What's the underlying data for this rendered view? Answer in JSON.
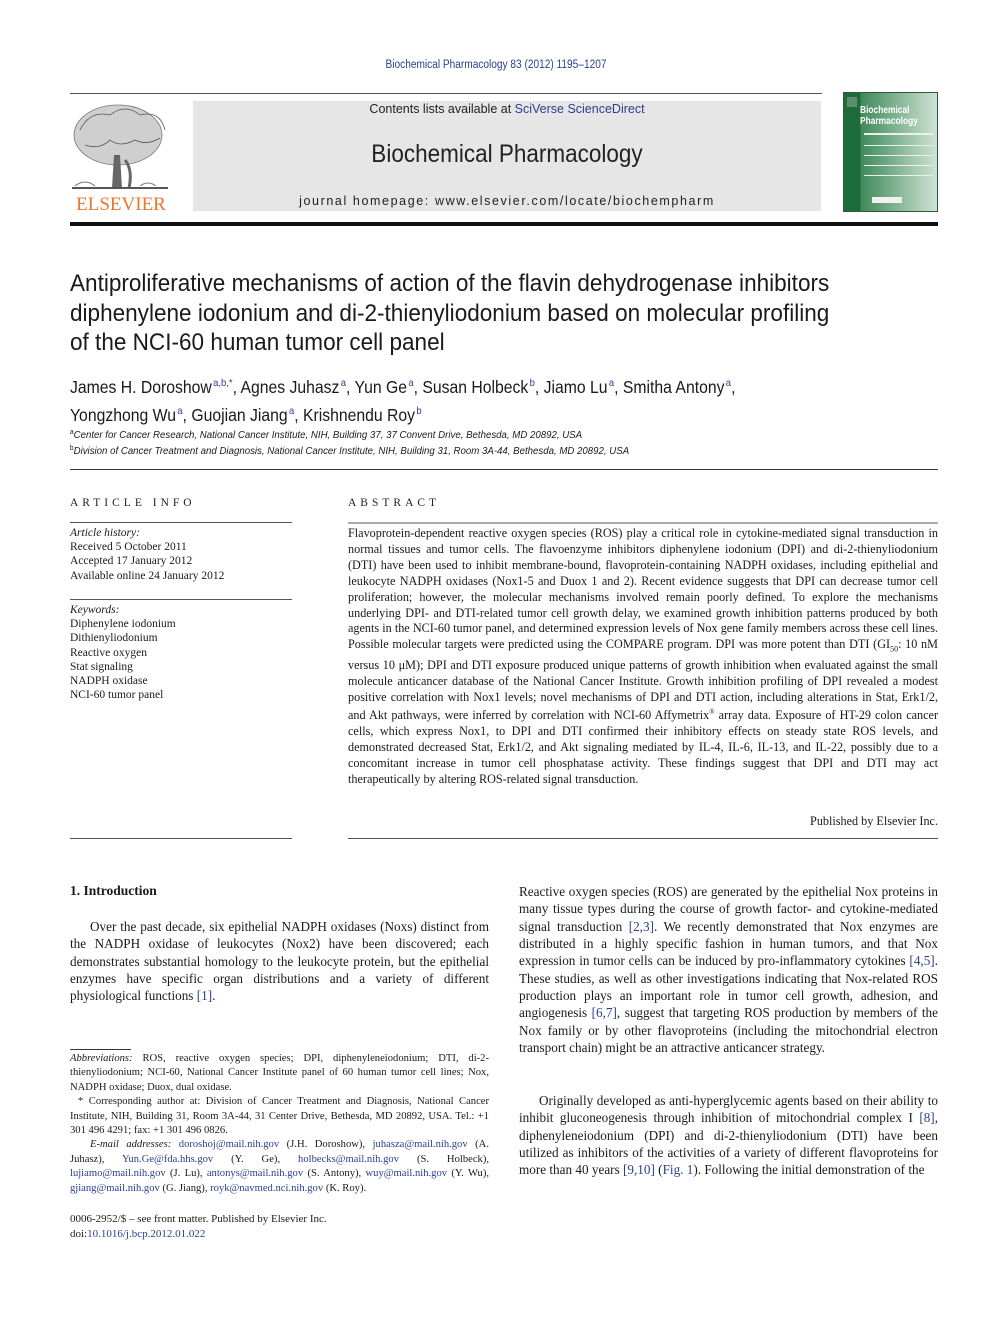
{
  "header": {
    "journal_ref": "Biochemical Pharmacology 83 (2012) 1195–1207",
    "contents_prefix": "Contents lists available at ",
    "contents_link": "SciVerse ScienceDirect",
    "journal_title": "Biochemical Pharmacology",
    "homepage": "journal homepage: www.elsevier.com/locate/biochempharm",
    "publisher_logo": "ELSEVIER",
    "cover_title_line1": "Biochemical",
    "cover_title_line2": "Pharmacology",
    "colors": {
      "link": "#2a3f8f",
      "elsevier_orange": "#e8762c",
      "cover_green": "#1e6b3c",
      "banner_gray": "#e6e6e6"
    }
  },
  "article": {
    "title_lines": [
      "Antiproliferative mechanisms of action of the flavin dehydrogenase inhibitors",
      "diphenylene iodonium and di-2-thienyliodonium based on molecular profiling",
      "of the NCI-60 human tumor cell panel"
    ],
    "authors": [
      {
        "name": "James H. Doroshow",
        "sup": "a,b,*"
      },
      {
        "name": "Agnes Juhasz",
        "sup": "a"
      },
      {
        "name": "Yun Ge",
        "sup": "a"
      },
      {
        "name": "Susan Holbeck",
        "sup": "b"
      },
      {
        "name": "Jiamo Lu",
        "sup": "a"
      },
      {
        "name": "Smitha Antony",
        "sup": "a"
      },
      {
        "name": "Yongzhong Wu",
        "sup": "a"
      },
      {
        "name": "Guojian Jiang",
        "sup": "a"
      },
      {
        "name": "Krishnendu Roy",
        "sup": "b"
      }
    ],
    "affiliations": [
      {
        "sup": "a",
        "text": "Center for Cancer Research, National Cancer Institute, NIH, Building 37, 37 Convent Drive, Bethesda, MD 20892, USA"
      },
      {
        "sup": "b",
        "text": "Division of Cancer Treatment and Diagnosis, National Cancer Institute, NIH, Building 31, Room 3A-44, Bethesda, MD 20892, USA"
      }
    ]
  },
  "article_info": {
    "heading": "ARTICLE INFO",
    "history_label": "Article history:",
    "history": [
      "Received 5 October 2011",
      "Accepted 17 January 2012",
      "Available online 24 January 2012"
    ],
    "keywords_label": "Keywords:",
    "keywords": [
      "Diphenylene iodonium",
      "Dithienyliodonium",
      "Reactive oxygen",
      "Stat signaling",
      "NADPH oxidase",
      "NCI-60 tumor panel"
    ]
  },
  "abstract": {
    "heading": "ABSTRACT",
    "text_part1": "Flavoprotein-dependent reactive oxygen species (ROS) play a critical role in cytokine-mediated signal transduction in normal tissues and tumor cells. The flavoenzyme inhibitors diphenylene iodonium (DPI) and di-2-thienyliodonium (DTI) have been used to inhibit membrane-bound, flavoprotein-containing NADPH oxidases, including epithelial and leukocyte NADPH oxidases (Nox1-5 and Duox 1 and 2). Recent evidence suggests that DPI can decrease tumor cell proliferation; however, the molecular mechanisms involved remain poorly defined. To explore the mechanisms underlying DPI- and DTI-related tumor cell growth delay, we examined growth inhibition patterns produced by both agents in the NCI-60 tumor panel, and determined expression levels of Nox gene family members across these cell lines. Possible molecular targets were predicted using the COMPARE program. DPI was more potent than DTI (GI",
    "text_sub": "50",
    "text_part2": ": 10 nM versus 10 μM); DPI and DTI exposure produced unique patterns of growth inhibition when evaluated against the small molecule anticancer database of the National Cancer Institute. Growth inhibition profiling of DPI revealed a modest positive correlation with Nox1 levels; novel mechanisms of DPI and DTI action, including alterations in Stat, Erk1/2, and Akt pathways, were inferred by correlation with NCI-60 Affymetrix",
    "text_reg": "®",
    "text_part3": " array data. Exposure of HT-29 colon cancer cells, which express Nox1, to DPI and DTI confirmed their inhibitory effects on steady state ROS levels, and demonstrated decreased Stat, Erk1/2, and Akt signaling mediated by IL-4, IL-6, IL-13, and IL-22, possibly due to a concomitant increase in tumor cell phosphatase activity. These findings suggest that DPI and DTI may act therapeutically by altering ROS-related signal transduction.",
    "published_by": "Published by Elsevier Inc."
  },
  "body": {
    "intro_heading": "1. Introduction",
    "intro_p1_text": "Over the past decade, six epithelial NADPH oxidases (Noxs) distinct from the NADPH oxidase of leukocytes (Nox2) have been discovered; each demonstrates substantial homology to the leukocyte protein, but the epithelial enzymes have specific organ distributions and a variety of different physiological functions ",
    "intro_p1_ref": "[1]",
    "col2_p1": [
      {
        "t": "Reactive oxygen species (ROS) are generated by the epithelial Nox proteins in many tissue types during the course of growth factor- and cytokine-mediated signal transduction "
      },
      {
        "ref": "[2,3]"
      },
      {
        "t": ". We recently demonstrated that Nox enzymes are distributed in a highly specific fashion in human tumors, and that Nox expression in tumor cells can be induced by pro-inflammatory cytokines "
      },
      {
        "ref": "[4,5]"
      },
      {
        "t": ". These studies, as well as other investigations indicating that Nox-related ROS production plays an important role in tumor cell growth, adhesion, and angiogenesis "
      },
      {
        "ref": "[6,7]"
      },
      {
        "t": ", suggest that targeting ROS production by members of the Nox family or by other flavoproteins (including the mitochondrial electron transport chain) might be an attractive anticancer strategy."
      }
    ],
    "col2_p2": [
      {
        "t": "Originally developed as anti-hyperglycemic agents based on their ability to inhibit gluconeogenesis through inhibition of mitochondrial complex I "
      },
      {
        "ref": "[8]"
      },
      {
        "t": ", diphenyleneiodonium (DPI) and di-2-thienyliodonium (DTI) have been utilized as inhibitors of the activities of a variety of different flavoproteins for more than 40 years "
      },
      {
        "ref": "[9,10]"
      },
      {
        "t": " ("
      },
      {
        "ref": "Fig. 1"
      },
      {
        "t": "). Following the initial demonstration of the"
      }
    ]
  },
  "footnotes": {
    "abbrev_label": "Abbreviations:",
    "abbrev_text": " ROS, reactive oxygen species; DPI, diphenyleneiodonium; DTI, di-2-thienyliodonium; NCI-60, National Cancer Institute panel of 60 human tumor cell lines; Nox, NADPH oxidase; Duox, dual oxidase.",
    "corresponding": "* Corresponding author at: Division of Cancer Treatment and Diagnosis, National Cancer Institute, NIH, Building 31, Room 3A-44, 31 Center Drive, Bethesda, MD 20892, USA. Tel.: +1 301 496 4291; fax: +1 301 496 0826.",
    "email_label": "E-mail addresses:",
    "emails": [
      {
        "addr": "doroshoj@mail.nih.gov",
        "who": "(J.H. Doroshow)"
      },
      {
        "addr": "juhasza@mail.nih.gov",
        "who": "(A. Juhasz)"
      },
      {
        "addr": "Yun.Ge@fda.hhs.gov",
        "who": "(Y. Ge)"
      },
      {
        "addr": "holbecks@mail.nih.gov",
        "who": "(S. Holbeck)"
      },
      {
        "addr": "lujiamo@mail.nih.gov",
        "who": "(J. Lu)"
      },
      {
        "addr": "antonys@mail.nih.gov",
        "who": "(S. Antony)"
      },
      {
        "addr": "wuy@mail.nih.gov",
        "who": "(Y. Wu)"
      },
      {
        "addr": "gjiang@mail.nih.gov",
        "who": "(G. Jiang)"
      },
      {
        "addr": "royk@navmed.nci.nih.gov",
        "who": "(K. Roy)."
      }
    ],
    "issn": "0006-2952/$ – see front matter. Published by Elsevier Inc.",
    "doi_label": "doi:",
    "doi": "10.1016/j.bcp.2012.01.022"
  }
}
